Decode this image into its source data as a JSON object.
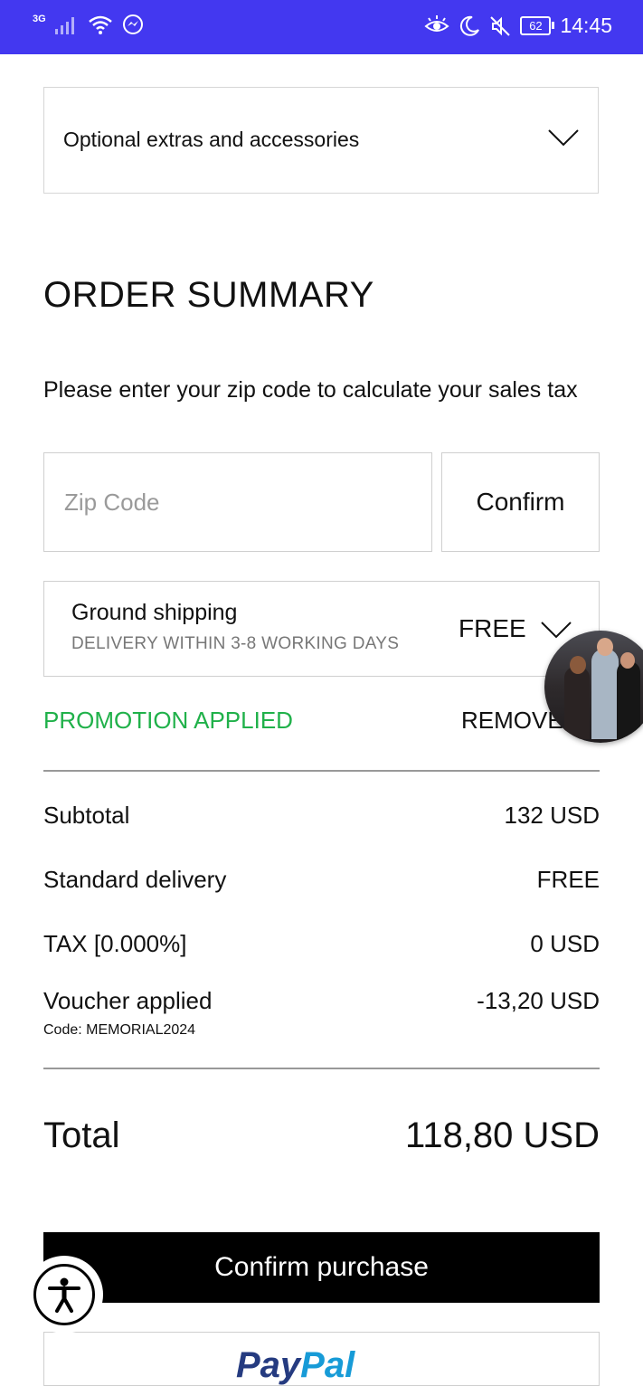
{
  "status_bar": {
    "network": "3G",
    "battery": "62",
    "time": "14:45",
    "background": "#4338f0"
  },
  "extras": {
    "label": "Optional extras and accessories"
  },
  "summary": {
    "title": "ORDER SUMMARY",
    "zip_prompt": "Please enter your zip code to calculate your sales tax",
    "zip_placeholder": "Zip Code",
    "zip_value": "",
    "confirm_label": "Confirm"
  },
  "shipping": {
    "name": "Ground shipping",
    "subtitle": "DELIVERY WITHIN 3-8 WORKING DAYS",
    "price": "FREE"
  },
  "promotion": {
    "label": "PROMOTION APPLIED",
    "remove_label": "REMOVE",
    "color": "#20b14a"
  },
  "lines": [
    {
      "label": "Subtotal",
      "value": "132 USD"
    },
    {
      "label": "Standard delivery",
      "value": "FREE"
    },
    {
      "label": "TAX [0.000%]",
      "value": "0 USD"
    },
    {
      "label": "Voucher applied",
      "value": "-13,20 USD",
      "code": "Code: MEMORIAL2024"
    }
  ],
  "total": {
    "label": "Total",
    "value": "118,80 USD"
  },
  "actions": {
    "confirm_purchase": "Confirm purchase",
    "paypal_pay": "Pay",
    "paypal_pal": "Pal"
  },
  "icons": {
    "signal": "signal-icon",
    "wifi": "wifi-icon",
    "messenger": "messenger-icon",
    "eye": "eye-comfort-icon",
    "moon": "do-not-disturb-icon",
    "mute": "muted-icon",
    "chevron": "chevron-down-icon",
    "accessibility": "accessibility-icon"
  }
}
